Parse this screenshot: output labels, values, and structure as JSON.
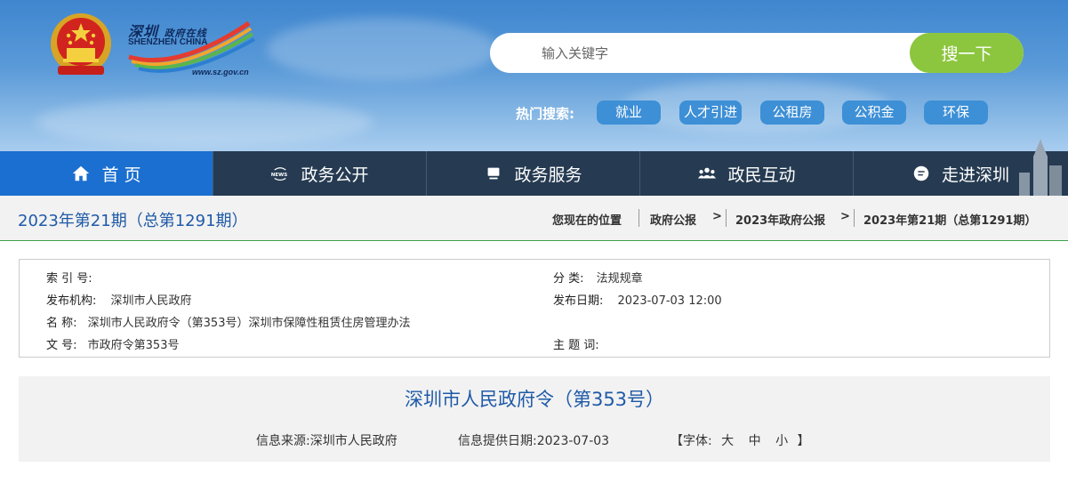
{
  "header": {
    "logo_cn": "深圳",
    "logo_cn_small": "政府在线",
    "logo_en": "SHENZHEN CHINA",
    "logo_url": "www.sz.gov.cn",
    "search": {
      "placeholder": "输入关键字",
      "button": "搜一下"
    },
    "hot": {
      "label": "热门搜索:",
      "tags": [
        "就业",
        "人才引进",
        "公租房",
        "公积金",
        "环保"
      ]
    }
  },
  "nav": {
    "items": [
      {
        "label": "首 页",
        "icon": "home-icon"
      },
      {
        "label": "政务公开",
        "icon": "news-icon"
      },
      {
        "label": "政务服务",
        "icon": "monitor-icon"
      },
      {
        "label": "政民互动",
        "icon": "people-icon"
      },
      {
        "label": "走进深圳",
        "icon": "chat-icon"
      }
    ]
  },
  "breadcrumb": {
    "issue": "2023年第21期（总第1291期）",
    "prefix": "您现在的位置",
    "items": [
      "政府公报",
      "2023年政府公报",
      "2023年第21期（总第1291期）"
    ],
    "separator": ">"
  },
  "meta": {
    "index_label": "索 引 号:",
    "index_value": "",
    "category_label": "分 类:",
    "category_value": "法规规章",
    "org_label": "发布机构:",
    "org_value": "深圳市人民政府",
    "date_label": "发布日期:",
    "date_value": "2023-07-03 12:00",
    "name_label": "名 称:",
    "name_value": "深圳市人民政府令（第353号）深圳市保障性租赁住房管理办法",
    "docno_label": "文 号:",
    "docno_value": "市政府令第353号",
    "topic_label": "主 题 词:",
    "topic_value": ""
  },
  "doc": {
    "title": "深圳市人民政府令（第353号）",
    "source_label": "信息来源:",
    "source_value": "深圳市人民政府",
    "date_label": "信息提供日期:",
    "date_value": "2023-07-03",
    "font_open": "【字体:",
    "font_large": "大",
    "font_medium": "中",
    "font_small": "小",
    "font_close": "】"
  },
  "colors": {
    "nav_bg": "#263b52",
    "nav_active": "#1a6fd0",
    "search_btn": "#8cc63f",
    "hot_tag": "#3d8fd6",
    "title_blue": "#1f5aa8",
    "accent_line": "#3aa04a"
  }
}
